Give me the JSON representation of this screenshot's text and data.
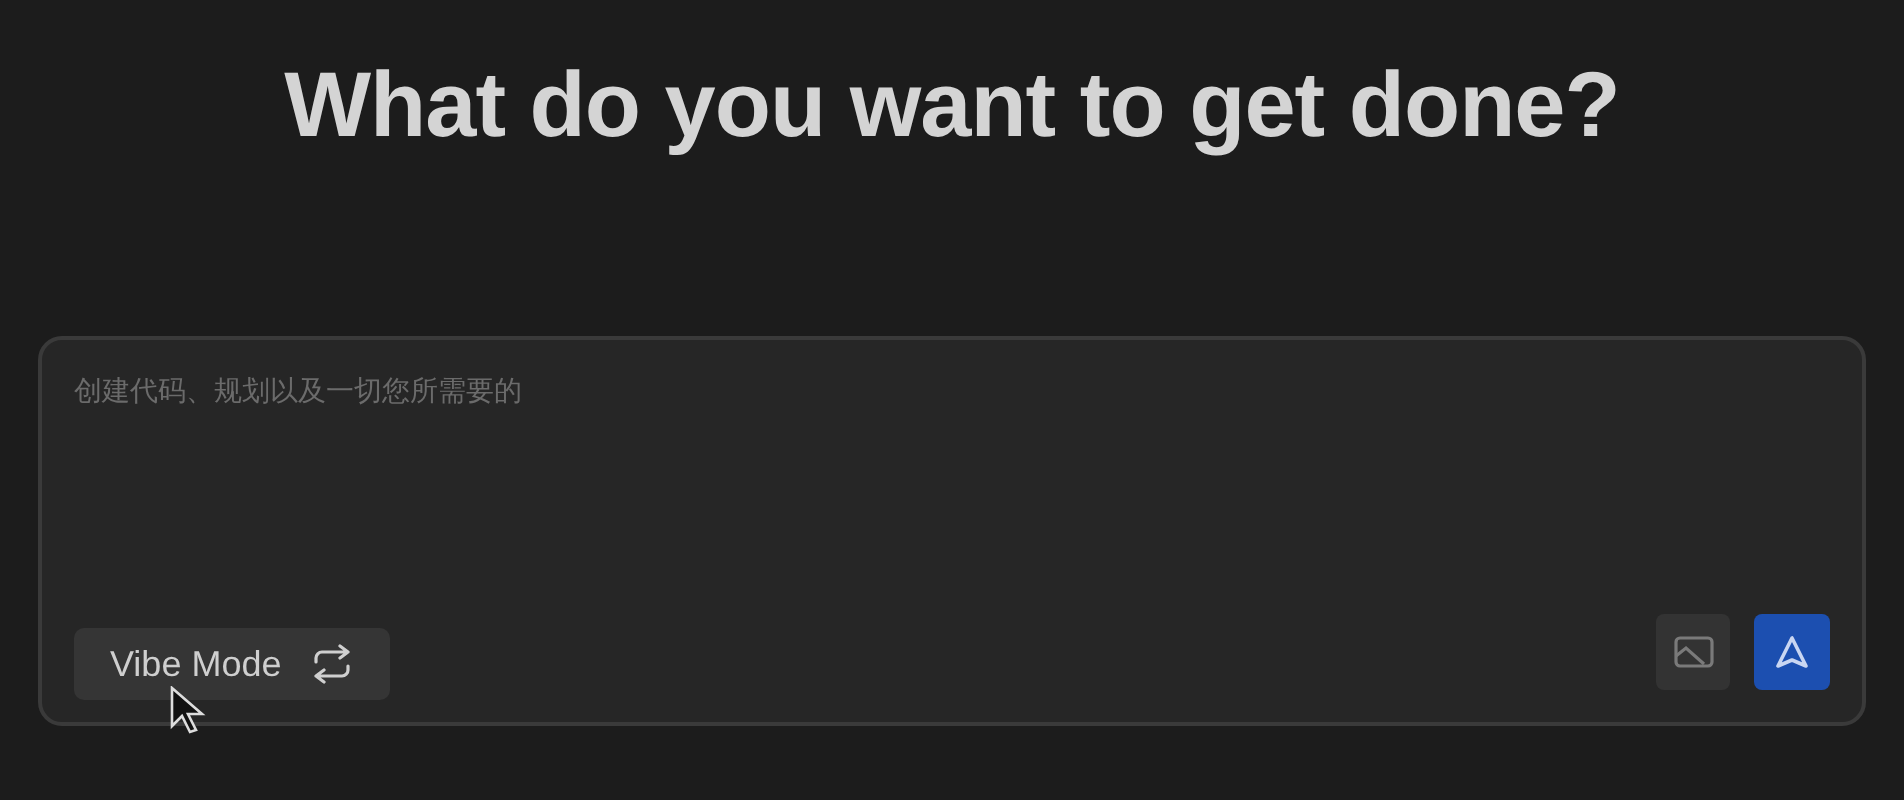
{
  "heading": "What do you want to get done?",
  "prompt": {
    "placeholder": "创建代码、规划以及一切您所需要的"
  },
  "mode_button": {
    "label": "Vibe Mode"
  }
}
